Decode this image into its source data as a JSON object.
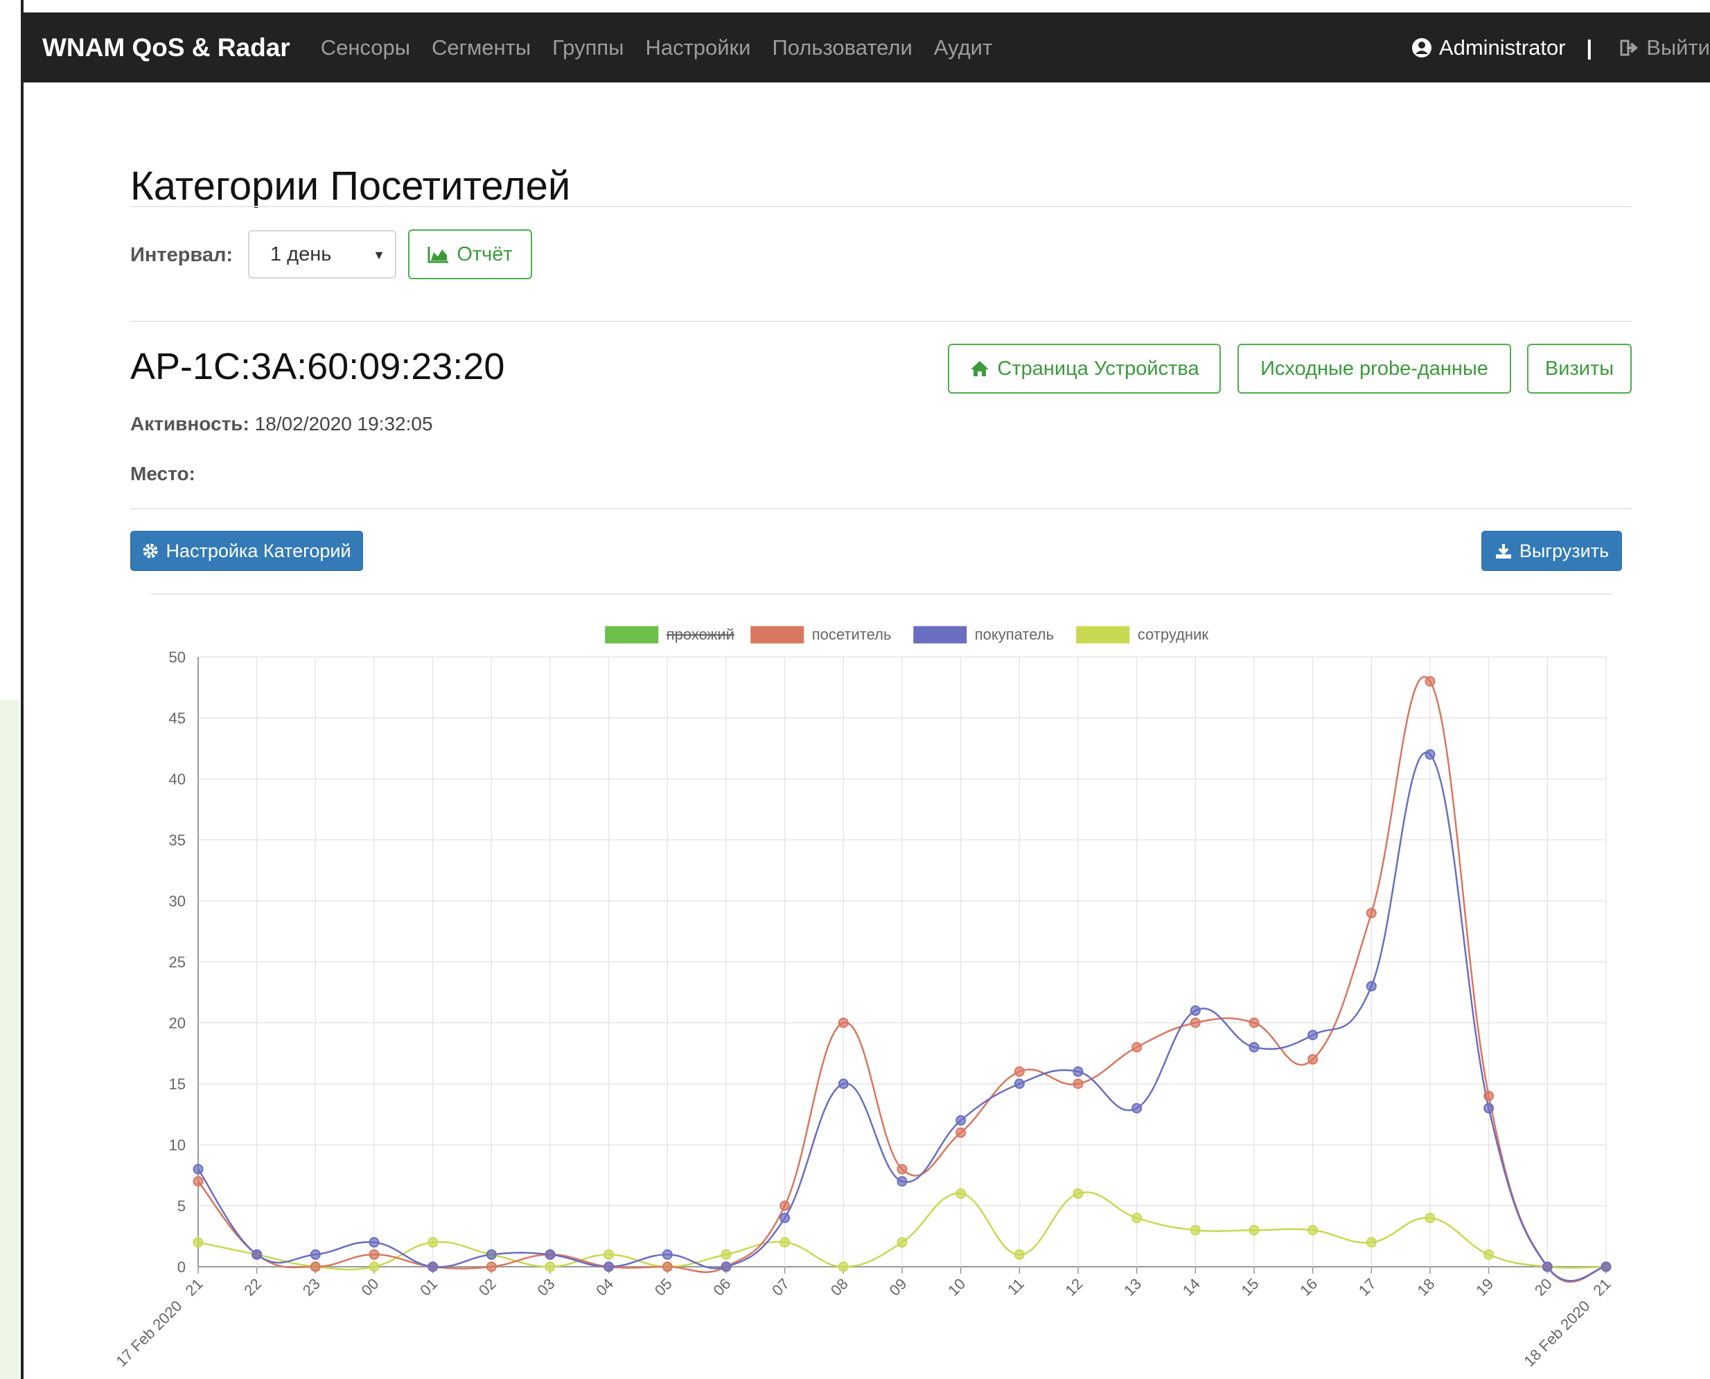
{
  "navbar": {
    "brand": "WNAM QoS & Radar",
    "items": [
      "Сенсоры",
      "Сегменты",
      "Группы",
      "Настройки",
      "Пользователи",
      "Аудит"
    ],
    "user": "Administrator",
    "separator": "|",
    "logout": "Выйти"
  },
  "page": {
    "title": "Категории Посетителей",
    "interval_label": "Интервал:",
    "interval_value": "1 день",
    "report_button": "Отчёт"
  },
  "device": {
    "id": "AP-1C:3A:60:09:23:20",
    "page_button": "Страница Устройства",
    "probe_button": "Исходные probe-данные",
    "visits_button": "Визиты",
    "activity_label": "Активность:",
    "activity_value": "18/02/2020 19:32:05",
    "place_label": "Место:",
    "place_value": ""
  },
  "actions": {
    "settings_button": "Настройка Категорий",
    "export_button": "Выгрузить"
  },
  "colors": {
    "accent_green": "#4cae4c",
    "primary_blue": "#337ab7",
    "navbar": "#222222"
  },
  "chart_data": {
    "type": "line",
    "categories": [
      "21",
      "22",
      "23",
      "00",
      "01",
      "02",
      "03",
      "04",
      "05",
      "06",
      "07",
      "08",
      "09",
      "10",
      "11",
      "12",
      "13",
      "14",
      "15",
      "16",
      "17",
      "18",
      "19",
      "20",
      "21"
    ],
    "date_labels": {
      "0": "17 Feb 2020",
      "24": "18 Feb 2020"
    },
    "ylim": [
      0,
      50
    ],
    "yticks": [
      0,
      5,
      10,
      15,
      20,
      25,
      30,
      35,
      40,
      45,
      50
    ],
    "grid": true,
    "legend": "top",
    "series": [
      {
        "name": "прохожий",
        "color": "#6cbf4a",
        "hidden": true,
        "values": []
      },
      {
        "name": "посетитель",
        "color": "#d9765f",
        "hidden": false,
        "values": [
          7,
          1,
          0,
          1,
          0,
          0,
          1,
          0,
          0,
          0,
          5,
          20,
          8,
          11,
          16,
          15,
          18,
          20,
          20,
          17,
          29,
          48,
          14,
          0,
          0
        ]
      },
      {
        "name": "покупатель",
        "color": "#6a6ec0",
        "hidden": false,
        "values": [
          8,
          1,
          1,
          2,
          0,
          1,
          1,
          0,
          1,
          0,
          4,
          15,
          7,
          12,
          15,
          16,
          13,
          21,
          18,
          19,
          23,
          42,
          13,
          0,
          0
        ]
      },
      {
        "name": "сотрудник",
        "color": "#c9d851",
        "hidden": false,
        "values": [
          2,
          1,
          0,
          0,
          2,
          1,
          0,
          1,
          0,
          1,
          2,
          0,
          2,
          6,
          1,
          6,
          4,
          3,
          3,
          3,
          2,
          4,
          1,
          0,
          0
        ]
      }
    ]
  }
}
